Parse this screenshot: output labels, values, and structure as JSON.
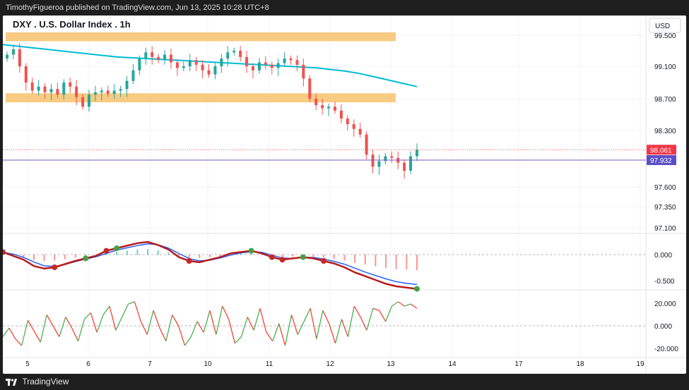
{
  "header": {
    "published_by": "TimothyFigueroa published on TradingView.com, Jun 13, 2025 10:28 UTC+8"
  },
  "footer": {
    "brand": "TradingView"
  },
  "chart_data": {
    "type": "candlestick",
    "title": "DXY . U.S. Dollar Index . 1h",
    "currency_label": "USD",
    "price_axis_ticks": [
      "99.500",
      "99.100",
      "98.700",
      "98.300",
      "97.600",
      "97.350",
      "97.100"
    ],
    "x_axis_ticks": [
      "5",
      "6",
      "7",
      "10",
      "11",
      "12",
      "13",
      "14",
      "17",
      "18",
      "19"
    ],
    "current_price_label": "98.061",
    "line_label": "97.932",
    "current_price": 98.061,
    "horizontal_line_value": 97.932,
    "resistance_zones": [
      {
        "low": 99.46,
        "high": 99.52
      },
      {
        "low": 98.69,
        "high": 98.75
      }
    ],
    "moving_average": [
      99.38,
      99.36,
      99.34,
      99.32,
      99.3,
      99.28,
      99.26,
      99.24,
      99.22,
      99.21,
      99.2,
      99.19,
      99.18,
      99.17,
      99.16,
      99.15,
      99.14,
      99.13,
      99.12,
      99.11,
      99.1,
      99.09,
      99.08,
      99.06,
      99.04,
      99.01,
      98.97,
      98.93,
      98.89,
      98.85
    ],
    "closes": [
      99.25,
      99.32,
      99.1,
      98.9,
      98.8,
      98.85,
      98.78,
      98.82,
      98.75,
      98.9,
      98.85,
      98.72,
      98.6,
      98.75,
      98.78,
      98.8,
      98.76,
      98.8,
      98.82,
      98.92,
      99.05,
      99.2,
      99.28,
      99.22,
      99.18,
      99.25,
      99.15,
      99.08,
      99.1,
      99.18,
      99.12,
      99.05,
      99.0,
      99.1,
      99.2,
      99.28,
      99.3,
      99.22,
      99.1,
      99.05,
      99.15,
      99.12,
      99.08,
      99.14,
      99.2,
      99.18,
      99.12,
      98.95,
      98.7,
      98.62,
      98.58,
      98.6,
      98.55,
      98.45,
      98.38,
      98.32,
      98.25,
      98.0,
      97.85,
      97.92,
      97.98,
      97.96,
      97.9,
      97.8,
      97.98,
      98.061
    ],
    "macd_panel": {
      "ticks": [
        "0.000",
        "-0.500"
      ],
      "signal_markers": "red/green circles at crossovers"
    },
    "oscillator_panel": {
      "ticks": [
        "20.000",
        "0.000",
        "-20.000"
      ],
      "values": [
        -10,
        -2,
        -12,
        -18,
        5,
        -5,
        -15,
        10,
        0,
        -10,
        8,
        -2,
        -14,
        6,
        12,
        -6,
        10,
        18,
        -4,
        8,
        20,
        22,
        4,
        -8,
        14,
        -2,
        -14,
        10,
        0,
        -18,
        -10,
        4,
        -6,
        14,
        -8,
        18,
        6,
        -16,
        -10,
        8,
        -4,
        16,
        -6,
        -14,
        2,
        -18,
        10,
        -8,
        4,
        16,
        -12,
        14,
        2,
        -16,
        6,
        -10,
        18,
        8,
        -4,
        16,
        14,
        4,
        18,
        22,
        18,
        20,
        16
      ]
    }
  }
}
